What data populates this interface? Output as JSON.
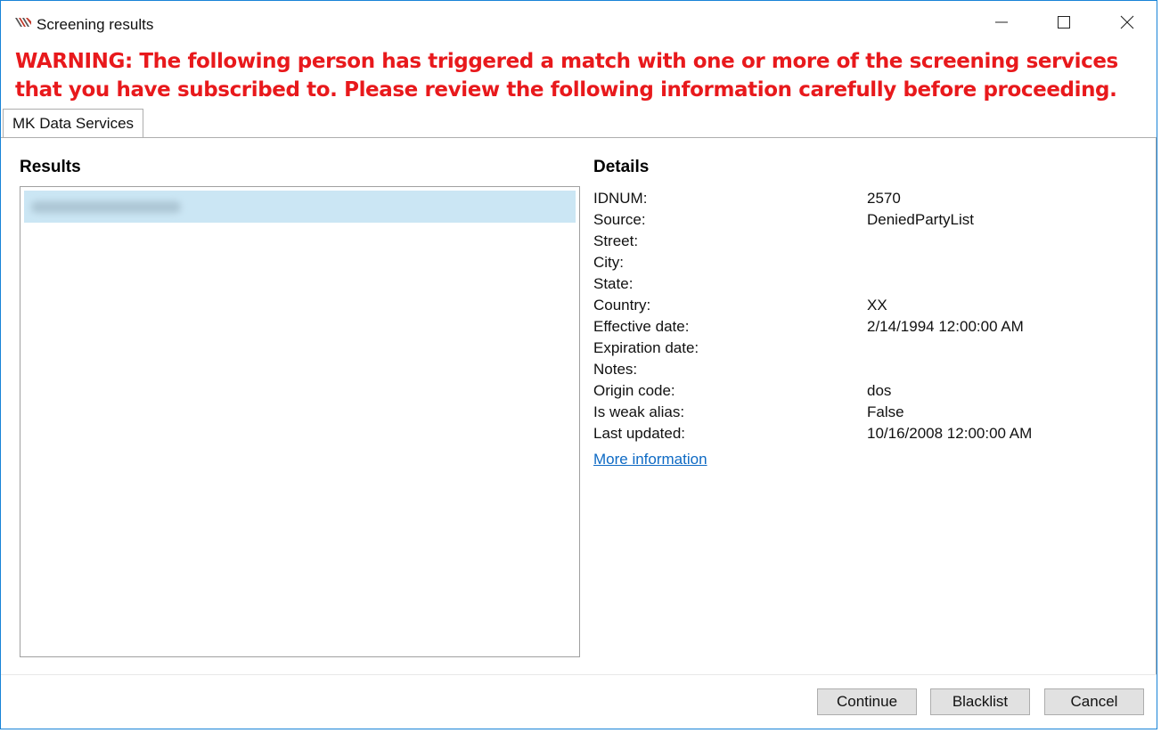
{
  "window": {
    "title": "Screening results",
    "controls": {
      "minimize": "minimize-icon",
      "maximize": "maximize-icon",
      "close": "close-icon"
    }
  },
  "warning": "WARNING: The following person has triggered a match with one or more of the screening services that you have subscribed to. Please review the following information carefully before proceeding.",
  "tabs": [
    {
      "label": "MK Data Services",
      "selected": true
    }
  ],
  "results": {
    "title": "Results",
    "items": [
      {
        "label": "",
        "selected": true,
        "blurred": true
      }
    ]
  },
  "details": {
    "title": "Details",
    "rows": [
      {
        "label": "IDNUM:",
        "value": "2570"
      },
      {
        "label": "Source:",
        "value": "DeniedPartyList"
      },
      {
        "label": "Street:",
        "value": ""
      },
      {
        "label": "City:",
        "value": ""
      },
      {
        "label": "State:",
        "value": ""
      },
      {
        "label": "Country:",
        "value": "XX"
      },
      {
        "label": "Effective date:",
        "value": "2/14/1994 12:00:00 AM"
      },
      {
        "label": "Expiration date:",
        "value": ""
      },
      {
        "label": "Notes:",
        "value": ""
      },
      {
        "label": "Origin code:",
        "value": "dos"
      },
      {
        "label": "Is weak alias:",
        "value": "False"
      },
      {
        "label": "Last updated:",
        "value": "10/16/2008 12:00:00 AM"
      }
    ],
    "more_link": "More information"
  },
  "buttons": {
    "continue": "Continue",
    "blacklist": "Blacklist",
    "cancel": "Cancel"
  },
  "colors": {
    "warning": "#e8191c",
    "selection": "#cbe6f4",
    "link": "#0e6ac4",
    "window_border": "#1883d7"
  }
}
